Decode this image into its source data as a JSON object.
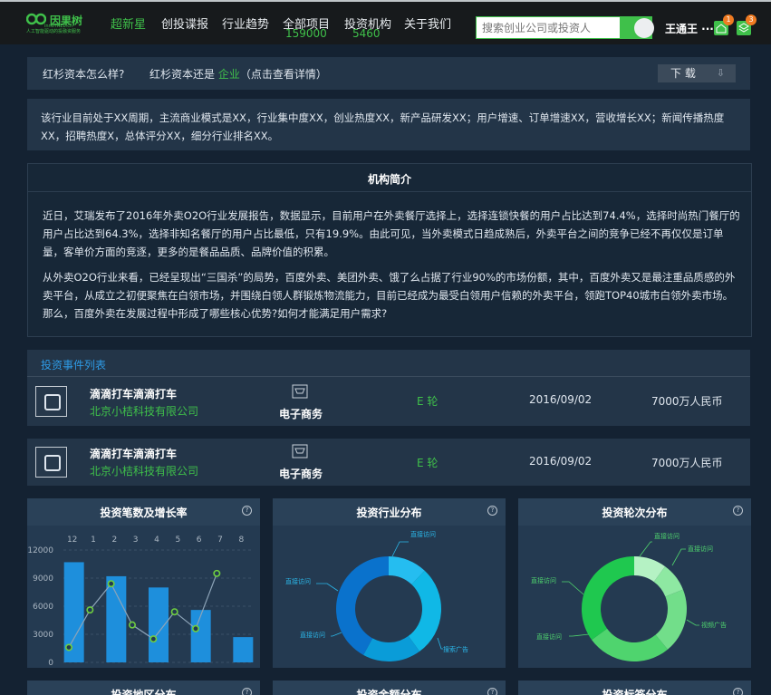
{
  "header": {
    "logo_text": "因果树",
    "logo_en": "innoTREE.cn",
    "logo_sub": "人工智能驱动的投融资服务",
    "nav": [
      {
        "label": "超新星",
        "active": true
      },
      {
        "label": "创投谍报",
        "active": false
      },
      {
        "label": "行业趋势",
        "active": false
      },
      {
        "label": "全部项目",
        "count": "159000",
        "active": false
      },
      {
        "label": "投资机构",
        "count": "5460",
        "active": false
      },
      {
        "label": "关于我们",
        "active": false
      }
    ],
    "search_placeholder": "搜索创业公司或投资人",
    "user_name": "王通王 ···",
    "notify_count_1": "1",
    "notify_count_2": "3"
  },
  "question_bar": {
    "question": "红杉资本怎么样?",
    "answer_prefix": "红杉资本还是",
    "answer_highlight": "企业",
    "answer_suffix": "（点击查看详情）",
    "download_label": "下 载"
  },
  "summary": "该行业目前处于XX周期，主流商业模式是XX，行业集中度XX，创业热度XX，新产品研发XX；用户增速、订单增速XX，营收增长XX；新闻传播热度XX，招聘热度X，总体评分XX，细分行业排名XX。",
  "intro": {
    "title": "机构简介",
    "paragraph_1": "近日，艾瑞发布了2016年外卖O2O行业发展报告，数据显示，目前用户在外卖餐厅选择上，选择连锁快餐的用户占比达到74.4%，选择时尚热门餐厅的用户占比达到64.3%，选择非知名餐厅的用户占比最低，只有19.9%。由此可见，当外卖模式日趋成熟后，外卖平台之间的竞争已经不再仅仅是订单量，客单价方面的竞逐，更多的是餐品品质、品牌价值的积累。",
    "paragraph_2": "从外卖O2O行业来看，已经呈现出“三国杀”的局势，百度外卖、美团外卖、饿了么占据了行业90%的市场份额，其中，百度外卖又是最注重品质感的外卖平台，从成立之初便聚焦在白领市场，并围绕白领人群锻炼物流能力，目前已经成为最受白领用户信赖的外卖平台，领跑TOP40城市白领外卖市场。那么，百度外卖在发展过程中形成了哪些核心优势?如何才能满足用户需求?"
  },
  "events": {
    "title": "投资事件列表",
    "rows": [
      {
        "name": "滴滴打车滴滴打车",
        "company": "北京小桔科技有限公司",
        "category": "电子商务",
        "round": "E 轮",
        "date": "2016/09/02",
        "amount": "7000万人民币"
      },
      {
        "name": "滴滴打车滴滴打车",
        "company": "北京小桔科技有限公司",
        "category": "电子商务",
        "round": "E 轮",
        "date": "2016/09/02",
        "amount": "7000万人民币"
      }
    ]
  },
  "cards": {
    "count_growth": {
      "title": "投资笔数及增长率",
      "help": "?"
    },
    "industry": {
      "title": "投资行业分布",
      "help": "?"
    },
    "round": {
      "title": "投资轮次分布",
      "help": "?"
    },
    "region": {
      "title": "投资地区分布",
      "help": "?"
    },
    "amount": {
      "title": "投资金额分布",
      "help": "?"
    },
    "tags": {
      "title": "投资标签分布",
      "help": "?"
    }
  },
  "chart_data": [
    {
      "type": "bar",
      "title": "投资笔数及增长率",
      "categories": [
        "12",
        "1",
        "2",
        "3",
        "4",
        "5",
        "6",
        "7",
        "8"
      ],
      "yticks": [
        "12000",
        "9000",
        "6000",
        "3000",
        "0"
      ],
      "ylim": [
        0,
        12000
      ],
      "series": [
        {
          "type": "bar",
          "x_indices": [
            0,
            2,
            4,
            6,
            8
          ],
          "values": [
            10700,
            9200,
            8000,
            5600,
            2700
          ],
          "color": "#1e8fdc"
        },
        {
          "type": "line",
          "x_positions": [
            -0.5,
            0.5,
            1.5,
            2.5,
            3.5,
            4.5,
            5.5,
            6.5,
            7.5
          ],
          "values": [
            1600,
            5600,
            8400,
            4000,
            2500,
            5400,
            3600,
            9500
          ],
          "color": "#8da4b8",
          "marker_color": "#6fcf3f"
        }
      ]
    },
    {
      "type": "pie",
      "title": "投资行业分布",
      "labels": [
        "直接访问",
        "直接访问",
        "直接访问",
        "搜索广告"
      ],
      "values": [
        12,
        28,
        18,
        42
      ],
      "colors": [
        "#25bdf0",
        "#10b8e6",
        "#0a9cd8",
        "#0a72cc"
      ]
    },
    {
      "type": "pie",
      "title": "投资轮次分布",
      "labels": [
        "直接访问",
        "直接访问",
        "直接访问",
        "直接访问",
        "视频广告"
      ],
      "values": [
        10,
        9,
        20,
        26,
        35
      ],
      "colors": [
        "#b5f2c4",
        "#8ee8a2",
        "#72de8a",
        "#4fd46e",
        "#1fc84f"
      ]
    }
  ]
}
